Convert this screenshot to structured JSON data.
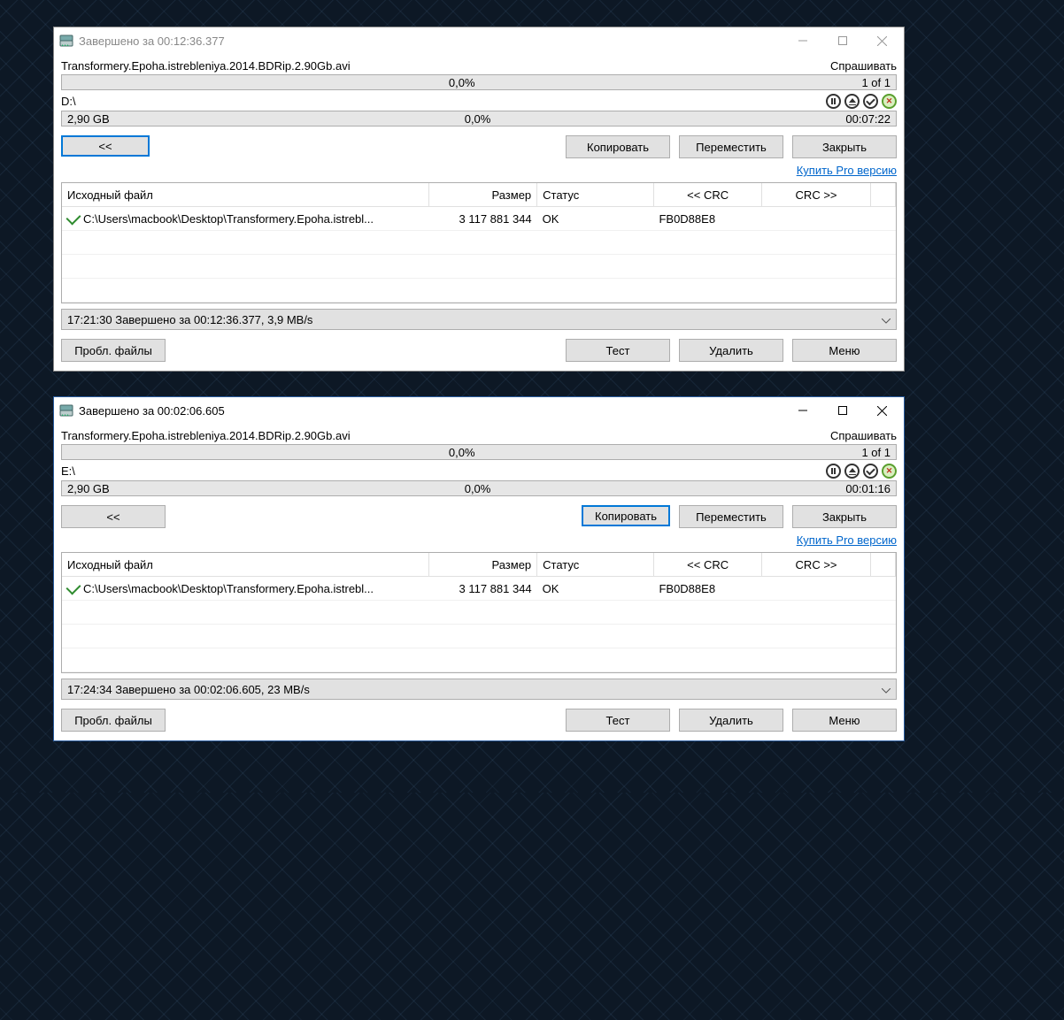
{
  "windows": [
    {
      "active": false,
      "title": "Завершено за 00:12:36.377",
      "file_label": "Transformery.Epoha.istrebleniya.2014.BDRip.2.90Gb.avi",
      "ask_label": "Спрашивать",
      "file_percent": "0,0%",
      "file_counter": "1 of 1",
      "dest_label": "D:\\",
      "size_label": "2,90 GB",
      "dest_percent": "0,0%",
      "time_label": "00:07:22",
      "back_btn": "<<",
      "copy_btn": "Копировать",
      "move_btn": "Переместить",
      "close_btn": "Закрыть",
      "buy_link": "Купить Pro версию",
      "back_active": true,
      "copy_active": false,
      "headers": {
        "src": "Исходный файл",
        "size": "Размер",
        "status": "Статус",
        "crc1": "<< CRC",
        "crc2": "CRC >>"
      },
      "row": {
        "path": "C:\\Users\\macbook\\Desktop\\Transformery.Epoha.istrebl...",
        "size": "3 117 881 344",
        "status": "OK",
        "crc1": "FB0D88E8",
        "crc2": ""
      },
      "status_line": "17:21:30 Завершено за 00:12:36.377, 3,9 MB/s",
      "problem_btn": "Пробл. файлы",
      "test_btn": "Тест",
      "delete_btn": "Удалить",
      "menu_btn": "Меню"
    },
    {
      "active": true,
      "title": "Завершено за 00:02:06.605",
      "file_label": "Transformery.Epoha.istrebleniya.2014.BDRip.2.90Gb.avi",
      "ask_label": "Спрашивать",
      "file_percent": "0,0%",
      "file_counter": "1 of 1",
      "dest_label": "E:\\",
      "size_label": "2,90 GB",
      "dest_percent": "0,0%",
      "time_label": "00:01:16",
      "back_btn": "<<",
      "copy_btn": "Копировать",
      "move_btn": "Переместить",
      "close_btn": "Закрыть",
      "buy_link": "Купить Pro версию",
      "back_active": false,
      "copy_active": true,
      "headers": {
        "src": "Исходный файл",
        "size": "Размер",
        "status": "Статус",
        "crc1": "<< CRC",
        "crc2": "CRC >>"
      },
      "row": {
        "path": "C:\\Users\\macbook\\Desktop\\Transformery.Epoha.istrebl...",
        "size": "3 117 881 344",
        "status": "OK",
        "crc1": "FB0D88E8",
        "crc2": ""
      },
      "status_line": "17:24:34 Завершено за 00:02:06.605, 23 MB/s",
      "problem_btn": "Пробл. файлы",
      "test_btn": "Тест",
      "delete_btn": "Удалить",
      "menu_btn": "Меню"
    }
  ]
}
